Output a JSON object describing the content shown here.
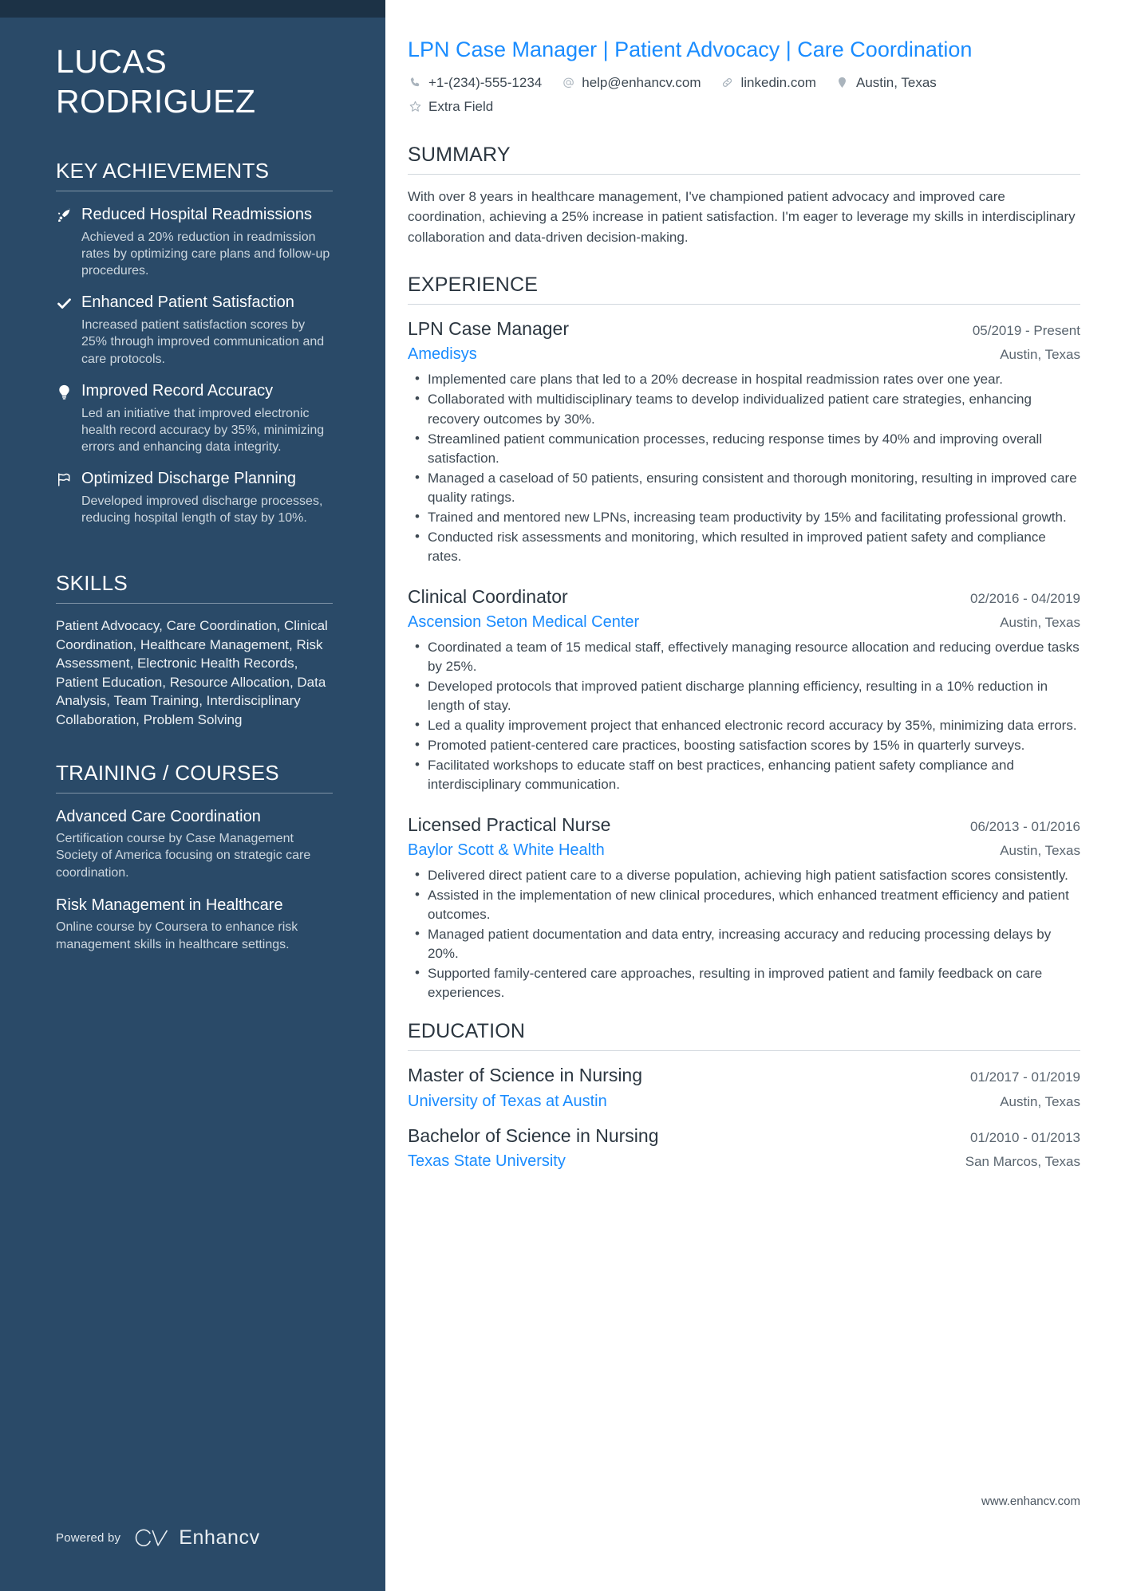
{
  "colors": {
    "sidebar_bg": "#2a4a68",
    "sidebar_topbar": "#1c3246",
    "accent_blue": "#1a8cff",
    "heading_dark": "#2b3640",
    "body_text": "#3d4852"
  },
  "sidebar": {
    "name_line1": "LUCAS",
    "name_line2": "RODRIGUEZ",
    "achievements_heading": "KEY ACHIEVEMENTS",
    "achievements": [
      {
        "icon": "rocket-trend-icon",
        "title": "Reduced Hospital Readmissions",
        "description": "Achieved a 20% reduction in readmission rates by optimizing care plans and follow-up procedures."
      },
      {
        "icon": "check-icon",
        "title": "Enhanced Patient Satisfaction",
        "description": "Increased patient satisfaction scores by 25% through improved communication and care protocols."
      },
      {
        "icon": "lightbulb-icon",
        "title": "Improved Record Accuracy",
        "description": "Led an initiative that improved electronic health record accuracy by 35%, minimizing errors and enhancing data integrity."
      },
      {
        "icon": "flag-icon",
        "title": "Optimized Discharge Planning",
        "description": "Developed improved discharge processes, reducing hospital length of stay by 10%."
      }
    ],
    "skills_heading": "SKILLS",
    "skills_text": "Patient Advocacy, Care Coordination, Clinical Coordination, Healthcare Management, Risk Assessment, Electronic Health Records, Patient Education, Resource Allocation, Data Analysis, Team Training, Interdisciplinary Collaboration, Problem Solving",
    "training_heading": "TRAINING / COURSES",
    "courses": [
      {
        "title": "Advanced Care Coordination",
        "description": "Certification course by Case Management Society of America focusing on strategic care coordination."
      },
      {
        "title": "Risk Management in Healthcare",
        "description": "Online course by Coursera to enhance risk management skills in healthcare settings."
      }
    ],
    "powered_by_label": "Powered by",
    "brand_name": "Enhancv"
  },
  "main": {
    "headline": "LPN Case Manager | Patient Advocacy | Care Coordination",
    "contacts": [
      {
        "icon": "phone-icon",
        "value": "+1-(234)-555-1234"
      },
      {
        "icon": "email-at-icon",
        "value": "help@enhancv.com"
      },
      {
        "icon": "link-icon",
        "value": "linkedin.com"
      },
      {
        "icon": "location-pin-icon",
        "value": "Austin, Texas"
      },
      {
        "icon": "star-icon",
        "value": "Extra Field"
      }
    ],
    "summary_heading": "SUMMARY",
    "summary_text": "With over 8 years in healthcare management, I've championed patient advocacy and improved care coordination, achieving a 25% increase in patient satisfaction. I'm eager to leverage my skills in interdisciplinary collaboration and data-driven decision-making.",
    "experience_heading": "EXPERIENCE",
    "experience": [
      {
        "title": "LPN Case Manager",
        "date": "05/2019 - Present",
        "org": "Amedisys",
        "location": "Austin, Texas",
        "bullets": [
          "Implemented care plans that led to a 20% decrease in hospital readmission rates over one year.",
          "Collaborated with multidisciplinary teams to develop individualized patient care strategies, enhancing recovery outcomes by 30%.",
          "Streamlined patient communication processes, reducing response times by 40% and improving overall satisfaction.",
          "Managed a caseload of 50 patients, ensuring consistent and thorough monitoring, resulting in improved care quality ratings.",
          "Trained and mentored new LPNs, increasing team productivity by 15% and facilitating professional growth.",
          "Conducted risk assessments and monitoring, which resulted in improved patient safety and compliance rates."
        ]
      },
      {
        "title": "Clinical Coordinator",
        "date": "02/2016 - 04/2019",
        "org": "Ascension Seton Medical Center",
        "location": "Austin, Texas",
        "bullets": [
          "Coordinated a team of 15 medical staff, effectively managing resource allocation and reducing overdue tasks by 25%.",
          "Developed protocols that improved patient discharge planning efficiency, resulting in a 10% reduction in length of stay.",
          "Led a quality improvement project that enhanced electronic record accuracy by 35%, minimizing data errors.",
          "Promoted patient-centered care practices, boosting satisfaction scores by 15% in quarterly surveys.",
          "Facilitated workshops to educate staff on best practices, enhancing patient safety compliance and interdisciplinary communication."
        ]
      },
      {
        "title": "Licensed Practical Nurse",
        "date": "06/2013 - 01/2016",
        "org": "Baylor Scott & White Health",
        "location": "Austin, Texas",
        "bullets": [
          "Delivered direct patient care to a diverse population, achieving high patient satisfaction scores consistently.",
          "Assisted in the implementation of new clinical procedures, which enhanced treatment efficiency and patient outcomes.",
          "Managed patient documentation and data entry, increasing accuracy and reducing processing delays by 20%.",
          "Supported family-centered care approaches, resulting in improved patient and family feedback on care experiences."
        ]
      }
    ],
    "education_heading": "EDUCATION",
    "education": [
      {
        "title": "Master of Science in Nursing",
        "date": "01/2017 - 01/2019",
        "org": "University of Texas at Austin",
        "location": "Austin, Texas"
      },
      {
        "title": "Bachelor of Science in Nursing",
        "date": "01/2010 - 01/2013",
        "org": "Texas State University",
        "location": "San Marcos, Texas"
      }
    ],
    "footer_url": "www.enhancv.com"
  }
}
